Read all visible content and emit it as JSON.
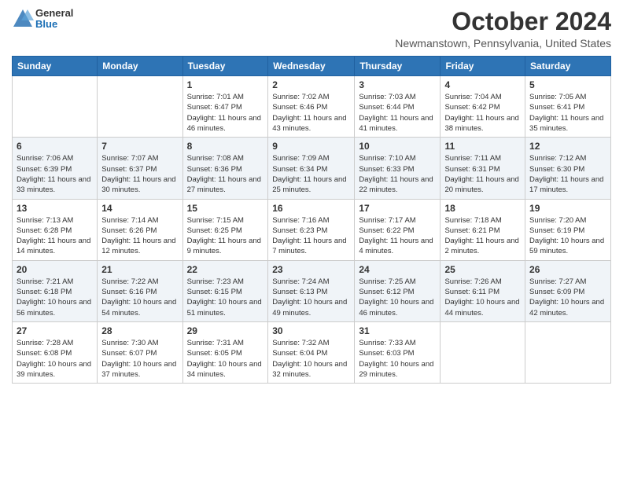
{
  "header": {
    "logo": {
      "general": "General",
      "blue": "Blue"
    },
    "title": "October 2024",
    "location": "Newmanstown, Pennsylvania, United States"
  },
  "columns": [
    "Sunday",
    "Monday",
    "Tuesday",
    "Wednesday",
    "Thursday",
    "Friday",
    "Saturday"
  ],
  "weeks": [
    [
      {
        "day": "",
        "info": ""
      },
      {
        "day": "",
        "info": ""
      },
      {
        "day": "1",
        "info": "Sunrise: 7:01 AM\nSunset: 6:47 PM\nDaylight: 11 hours and 46 minutes."
      },
      {
        "day": "2",
        "info": "Sunrise: 7:02 AM\nSunset: 6:46 PM\nDaylight: 11 hours and 43 minutes."
      },
      {
        "day": "3",
        "info": "Sunrise: 7:03 AM\nSunset: 6:44 PM\nDaylight: 11 hours and 41 minutes."
      },
      {
        "day": "4",
        "info": "Sunrise: 7:04 AM\nSunset: 6:42 PM\nDaylight: 11 hours and 38 minutes."
      },
      {
        "day": "5",
        "info": "Sunrise: 7:05 AM\nSunset: 6:41 PM\nDaylight: 11 hours and 35 minutes."
      }
    ],
    [
      {
        "day": "6",
        "info": "Sunrise: 7:06 AM\nSunset: 6:39 PM\nDaylight: 11 hours and 33 minutes."
      },
      {
        "day": "7",
        "info": "Sunrise: 7:07 AM\nSunset: 6:37 PM\nDaylight: 11 hours and 30 minutes."
      },
      {
        "day": "8",
        "info": "Sunrise: 7:08 AM\nSunset: 6:36 PM\nDaylight: 11 hours and 27 minutes."
      },
      {
        "day": "9",
        "info": "Sunrise: 7:09 AM\nSunset: 6:34 PM\nDaylight: 11 hours and 25 minutes."
      },
      {
        "day": "10",
        "info": "Sunrise: 7:10 AM\nSunset: 6:33 PM\nDaylight: 11 hours and 22 minutes."
      },
      {
        "day": "11",
        "info": "Sunrise: 7:11 AM\nSunset: 6:31 PM\nDaylight: 11 hours and 20 minutes."
      },
      {
        "day": "12",
        "info": "Sunrise: 7:12 AM\nSunset: 6:30 PM\nDaylight: 11 hours and 17 minutes."
      }
    ],
    [
      {
        "day": "13",
        "info": "Sunrise: 7:13 AM\nSunset: 6:28 PM\nDaylight: 11 hours and 14 minutes."
      },
      {
        "day": "14",
        "info": "Sunrise: 7:14 AM\nSunset: 6:26 PM\nDaylight: 11 hours and 12 minutes."
      },
      {
        "day": "15",
        "info": "Sunrise: 7:15 AM\nSunset: 6:25 PM\nDaylight: 11 hours and 9 minutes."
      },
      {
        "day": "16",
        "info": "Sunrise: 7:16 AM\nSunset: 6:23 PM\nDaylight: 11 hours and 7 minutes."
      },
      {
        "day": "17",
        "info": "Sunrise: 7:17 AM\nSunset: 6:22 PM\nDaylight: 11 hours and 4 minutes."
      },
      {
        "day": "18",
        "info": "Sunrise: 7:18 AM\nSunset: 6:21 PM\nDaylight: 11 hours and 2 minutes."
      },
      {
        "day": "19",
        "info": "Sunrise: 7:20 AM\nSunset: 6:19 PM\nDaylight: 10 hours and 59 minutes."
      }
    ],
    [
      {
        "day": "20",
        "info": "Sunrise: 7:21 AM\nSunset: 6:18 PM\nDaylight: 10 hours and 56 minutes."
      },
      {
        "day": "21",
        "info": "Sunrise: 7:22 AM\nSunset: 6:16 PM\nDaylight: 10 hours and 54 minutes."
      },
      {
        "day": "22",
        "info": "Sunrise: 7:23 AM\nSunset: 6:15 PM\nDaylight: 10 hours and 51 minutes."
      },
      {
        "day": "23",
        "info": "Sunrise: 7:24 AM\nSunset: 6:13 PM\nDaylight: 10 hours and 49 minutes."
      },
      {
        "day": "24",
        "info": "Sunrise: 7:25 AM\nSunset: 6:12 PM\nDaylight: 10 hours and 46 minutes."
      },
      {
        "day": "25",
        "info": "Sunrise: 7:26 AM\nSunset: 6:11 PM\nDaylight: 10 hours and 44 minutes."
      },
      {
        "day": "26",
        "info": "Sunrise: 7:27 AM\nSunset: 6:09 PM\nDaylight: 10 hours and 42 minutes."
      }
    ],
    [
      {
        "day": "27",
        "info": "Sunrise: 7:28 AM\nSunset: 6:08 PM\nDaylight: 10 hours and 39 minutes."
      },
      {
        "day": "28",
        "info": "Sunrise: 7:30 AM\nSunset: 6:07 PM\nDaylight: 10 hours and 37 minutes."
      },
      {
        "day": "29",
        "info": "Sunrise: 7:31 AM\nSunset: 6:05 PM\nDaylight: 10 hours and 34 minutes."
      },
      {
        "day": "30",
        "info": "Sunrise: 7:32 AM\nSunset: 6:04 PM\nDaylight: 10 hours and 32 minutes."
      },
      {
        "day": "31",
        "info": "Sunrise: 7:33 AM\nSunset: 6:03 PM\nDaylight: 10 hours and 29 minutes."
      },
      {
        "day": "",
        "info": ""
      },
      {
        "day": "",
        "info": ""
      }
    ]
  ]
}
